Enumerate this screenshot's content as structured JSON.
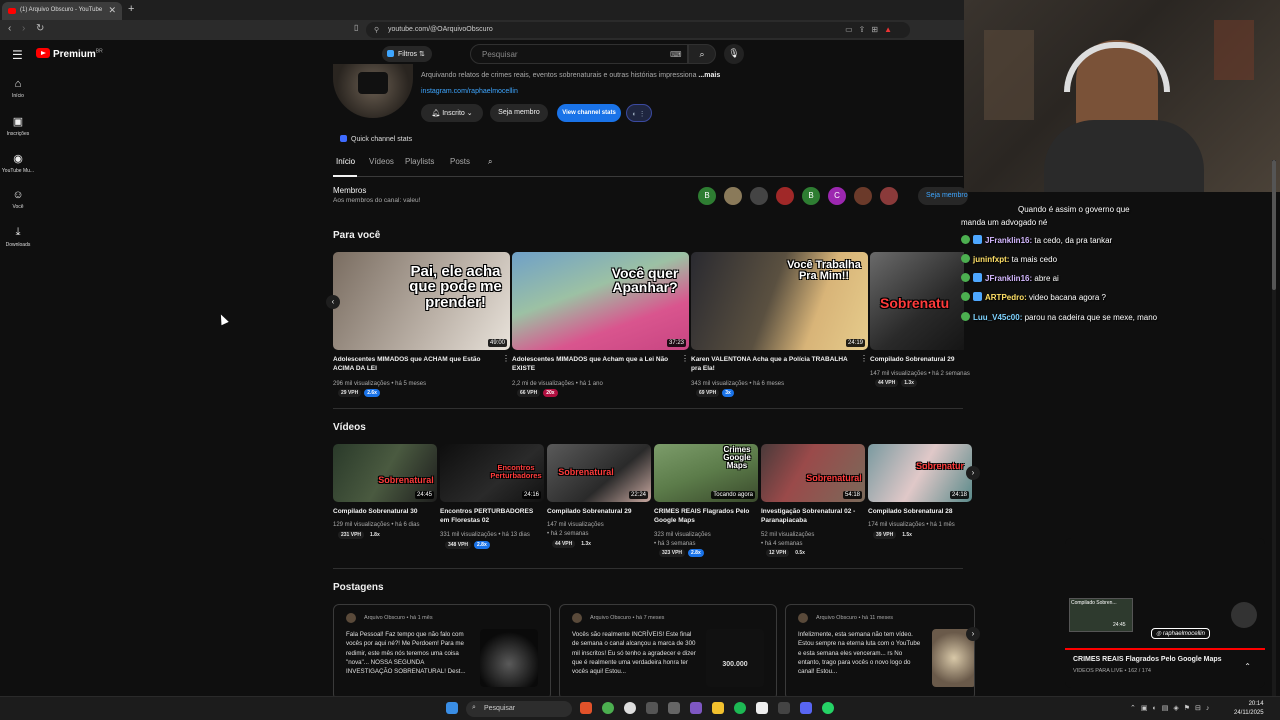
{
  "browser": {
    "tab_title": "(1) Arquivo Obscuro - YouTube",
    "url": "youtube.com/@OArquivoObscuro"
  },
  "header": {
    "logo_text": "Premium",
    "logo_sup": "BR",
    "filters_label": "Filtros",
    "search_placeholder": "Pesquisar"
  },
  "sidebar": {
    "items": [
      {
        "label": "Início",
        "icon": "home-icon"
      },
      {
        "label": "Inscrições",
        "icon": "subscriptions-icon"
      },
      {
        "label": "YouTube Mu...",
        "icon": "music-icon"
      },
      {
        "label": "Você",
        "icon": "you-icon"
      },
      {
        "label": "Downloads",
        "icon": "download-icon"
      }
    ]
  },
  "channel": {
    "description": "Arquivando relatos de crimes reais, eventos sobrenaturais e outras histórias impressiona",
    "more": "...mais",
    "link": "instagram.com/raphaelmocellin",
    "subscribe_label": "Inscrito",
    "join_label": "Seja membro",
    "stats_label": "View channel stats",
    "quick_stats": "Quick channel stats",
    "tabs": [
      "Início",
      "Vídeos",
      "Playlists",
      "Posts"
    ]
  },
  "members": {
    "title": "Membros",
    "subtitle": "Aos membros do canal: valeu!",
    "avatars": [
      "B",
      "",
      "",
      "",
      "B",
      "C",
      "",
      ""
    ],
    "join_label": "Seja membro"
  },
  "for_you": {
    "title": "Para você",
    "videos": [
      {
        "caption": "Pai, ele acha que pode me prender!",
        "duration": "49:00",
        "title": "Adolescentes MIMADOS que ACHAM que Estão ACIMA DA LEI",
        "meta": "296 mil visualizações • há 5 meses",
        "vph": "29 VPH",
        "mult": "2.6x",
        "mult_color": "blue"
      },
      {
        "caption": "Você quer Apanhar?",
        "duration": "37:23",
        "title": "Adolescentes MIMADOS que Acham que a Lei Não EXISTE",
        "meta": "2,2 mi de visualizações • há 1 ano",
        "vph": "66 VPH",
        "mult": "20x",
        "mult_color": "red"
      },
      {
        "caption": "Você Trabalha Pra Mim!!",
        "duration": "24:19",
        "title": "Karen VALENTONA Acha que a Polícia TRABALHA pra Ela!",
        "meta": "343 mil visualizações • há 6 meses",
        "vph": "69 VPH",
        "mult": "3x",
        "mult_color": "blue"
      },
      {
        "caption": "Sobrenatu",
        "duration": "",
        "title": "Compilado Sobrenatural 29",
        "meta": "147 mil visualizações • há 2 semanas",
        "vph": "44 VPH",
        "mult": "1.3x",
        "mult_color": "dark"
      }
    ]
  },
  "videos": {
    "title": "Vídeos",
    "items": [
      {
        "caption": "Sobrenatural",
        "duration": "24:45",
        "title": "Compilado Sobrenatural 30",
        "meta1": "129 mil visualizações • há 6 dias",
        "meta2": "",
        "vph": "231 VPH",
        "mult": "1.8x",
        "mult_color": "dark"
      },
      {
        "caption": "Encontros Perturbadores",
        "duration": "24:16",
        "title": "Encontros PERTURBADORES em Florestas 02",
        "meta1": "331 mil visualizações • há 13 dias",
        "meta2": "",
        "vph": "348 VPH",
        "mult": "2.8x",
        "mult_color": "blue"
      },
      {
        "caption": "Sobrenatural",
        "duration": "22:24",
        "title": "Compilado Sobrenatural 29",
        "meta1": "147 mil visualizações",
        "meta2": "• há 2 semanas",
        "vph": "44 VPH",
        "mult": "1.3x",
        "mult_color": "dark"
      },
      {
        "caption": "Crimes Google Maps",
        "duration": "Tocando agora",
        "title": "CRIMES REAIS Flagrados Pelo Google Maps",
        "meta1": "323 mil visualizações",
        "meta2": "• há 3 semanas",
        "vph": "323 VPH",
        "mult": "2.8x",
        "mult_color": "blue"
      },
      {
        "caption": "Sobrenatural",
        "duration": "54:18",
        "title": "Investigação Sobrenatural 02 - Paranapiacaba",
        "meta1": "52 mil visualizações",
        "meta2": "• há 4 semanas",
        "vph": "12 VPH",
        "mult": "0.5x",
        "mult_color": "dark"
      },
      {
        "caption": "Sobrenatur",
        "duration": "24:18",
        "title": "Compilado Sobrenatural 28",
        "meta1": "174 mil visualizações • há 1 mês",
        "meta2": "",
        "vph": "39 VPH",
        "mult": "1.5x",
        "mult_color": "dark"
      }
    ]
  },
  "posts": {
    "title": "Postagens",
    "items": [
      {
        "author": "Arquivo Obscuro",
        "time": "há 1 mês",
        "text": "Fala Pessoal! Faz tempo que não falo com vocês por aqui né?! Me Perdoem! Para me redimir, este mês nós teremos uma coisa \"nova\"... NOSSA SEGUNDA INVESTIGAÇÃO SOBRENATURAL! Dest...",
        "image_text": ""
      },
      {
        "author": "Arquivo Obscuro",
        "time": "há 7 meses",
        "text": "Vocês são realmente INCRÍVEIS! Este final de semana o canal alcançou a marca de 300 mil inscritos! Eu só tenho a agradecer e dizer que é realmente uma verdadeira honra ter vocês aqui! Estou...",
        "image_text": "300.000"
      },
      {
        "author": "Arquivo Obscuro",
        "time": "há 11 meses",
        "text": "Infelizmente, esta semana não tem vídeo. Estou sempre na eterna luta com o YouTube e esta semana eles venceram... rs No entanto, trago para vocês o novo logo do canal! Estou...",
        "image_text": ""
      }
    ]
  },
  "chat": {
    "lines": [
      {
        "user": "",
        "msg": "Quando é assim o governo que",
        "color": ""
      },
      {
        "user": "",
        "msg": "manda um advogado né",
        "color": ""
      },
      {
        "user": "JFranklin16:",
        "msg": "ta cedo, da pra tankar",
        "color": "purple"
      },
      {
        "user": "juninfxpt:",
        "msg": "ta mais cedo",
        "color": "y"
      },
      {
        "user": "JFranklin16:",
        "msg": "abre ai",
        "color": "purple"
      },
      {
        "user": "ARTPedro:",
        "msg": "video bacana agora ?",
        "color": "y"
      },
      {
        "user": "Luu_V45c00:",
        "msg": "parou na cadeira que se mexe, mano",
        "color": "b"
      }
    ]
  },
  "mini_player": {
    "thumb_title": "Compilado Sobren...",
    "thumb_duration": "24:45",
    "instagram": "raphaelmocellin",
    "title": "CRIMES REAIS Flagrados Pelo Google Maps",
    "subtitle": "VIDEOS PARA LIVE • 162 / 174"
  },
  "taskbar": {
    "search_label": "Pesquisar",
    "time": "20:14",
    "date": "24/11/2025"
  }
}
